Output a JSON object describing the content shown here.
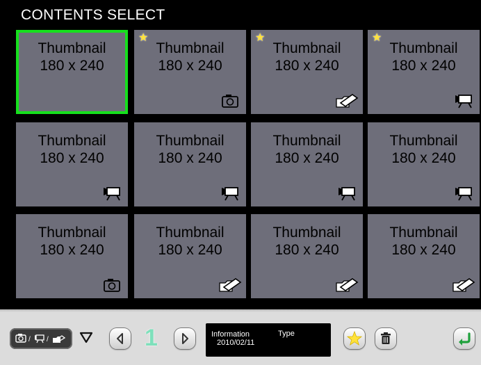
{
  "header": {
    "title": "CONTENTS SELECT"
  },
  "tiles": [
    {
      "line1": "Thumbnail",
      "line2": "180 x 240",
      "starred": false,
      "selected": true,
      "icon": ""
    },
    {
      "line1": "Thumbnail",
      "line2": "180 x 240",
      "starred": true,
      "selected": false,
      "icon": "camera-icon"
    },
    {
      "line1": "Thumbnail",
      "line2": "180 x 240",
      "starred": true,
      "selected": false,
      "icon": "folder-brush-icon"
    },
    {
      "line1": "Thumbnail",
      "line2": "180 x 240",
      "starred": true,
      "selected": false,
      "icon": "video-camera-icon"
    },
    {
      "line1": "Thumbnail",
      "line2": "180 x 240",
      "starred": false,
      "selected": false,
      "icon": "video-camera-icon"
    },
    {
      "line1": "Thumbnail",
      "line2": "180 x 240",
      "starred": false,
      "selected": false,
      "icon": "video-camera-icon"
    },
    {
      "line1": "Thumbnail",
      "line2": "180 x 240",
      "starred": false,
      "selected": false,
      "icon": "video-camera-icon"
    },
    {
      "line1": "Thumbnail",
      "line2": "180 x 240",
      "starred": false,
      "selected": false,
      "icon": "video-camera-icon"
    },
    {
      "line1": "Thumbnail",
      "line2": "180 x 240",
      "starred": false,
      "selected": false,
      "icon": "camera-icon"
    },
    {
      "line1": "Thumbnail",
      "line2": "180 x 240",
      "starred": false,
      "selected": false,
      "icon": "folder-brush-icon"
    },
    {
      "line1": "Thumbnail",
      "line2": "180 x 240",
      "starred": false,
      "selected": false,
      "icon": "folder-brush-icon"
    },
    {
      "line1": "Thumbnail",
      "line2": "180 x 240",
      "starred": false,
      "selected": false,
      "icon": "folder-brush-icon"
    }
  ],
  "toolbar": {
    "filter_icons": [
      "camera-icon",
      "video-camera-icon",
      "folder-brush-icon"
    ],
    "filter_separator": "/",
    "page": "1",
    "info_label": "Information",
    "info_type": "Type",
    "info_date": "2010/02/11"
  },
  "colors": {
    "background": "#000000",
    "tile": "#6e6e7a",
    "selection": "#16e01d",
    "star": "#ffe23a",
    "toolbar": "#dcdcdc",
    "page_number": "#7ee0bb",
    "back_arrow": "#1fa13c"
  }
}
